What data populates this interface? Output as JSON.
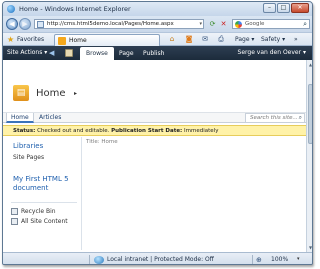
{
  "window": {
    "title": "Home - Windows Internet Explorer",
    "minimize_glyph": "–",
    "maximize_glyph": "□",
    "close_glyph": "✕"
  },
  "address_bar": {
    "url": "http://cms.html5demo.local/Pages/Home.aspx",
    "search_placeholder": "Google"
  },
  "favorites_bar": {
    "favorites_label": "Favorites",
    "tab_label": "Home"
  },
  "command_bar": {
    "page_label": "Page ▾",
    "safety_label": "Safety ▾",
    "tools_label": "»"
  },
  "sharepoint": {
    "site_actions": "Site Actions ▾",
    "ribbon_tabs": [
      "Browse",
      "Page",
      "Publish"
    ],
    "user_name": "Serge van den Oever ▾",
    "page_title": "Home",
    "page_title_caret": "▸",
    "top_nav": [
      "Home",
      "Articles"
    ],
    "search_placeholder": "Search this site...",
    "status": {
      "label": "Status:",
      "text": "Checked out and editable.",
      "pub_label": "Publication Start Date:",
      "pub_value": "Immediately"
    },
    "quick_launch": {
      "libraries": "Libraries",
      "site_pages": "Site Pages",
      "document_link": "My First HTML 5 document",
      "recycle_bin": "Recycle Bin",
      "all_site_content": "All Site Content"
    },
    "title_field": "Title: Home"
  },
  "status_bar": {
    "zone": "Local intranet | Protected Mode: Off",
    "zoom": "100%",
    "zoom_dd": "▾"
  },
  "colors": {
    "ribbon_dark": "#1c2b3b",
    "status_yellow": "#fff2a8",
    "link_blue": "#1e5fae"
  }
}
